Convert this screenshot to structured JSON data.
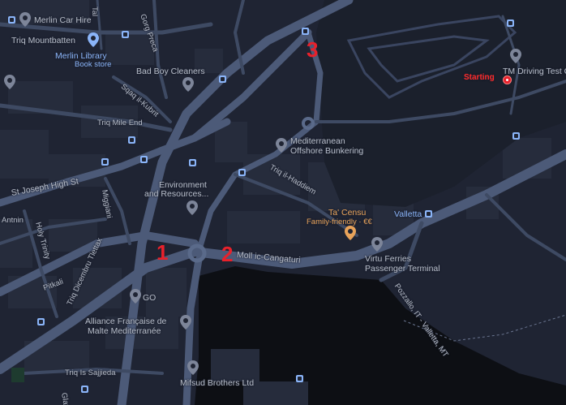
{
  "map": {
    "colors": {
      "background": "#1f2433",
      "water": "#0d0f14",
      "road": "#3e4a63",
      "road_major": "#4c5a78",
      "building": "#262c3c",
      "label": "#b7bdc9",
      "transit": "#8ab4f8",
      "marker": "#e8212b"
    },
    "numbers": {
      "one": "1",
      "two": "2",
      "three": "3"
    },
    "places": {
      "merlin_car_hire": "Merlin Car Hire",
      "triq_mountbatten": "Triq Mountbatten",
      "merlin_library": "Merlin Library",
      "book_store": "Book store",
      "bad_boy_cleaners": "Bad Boy Cleaners",
      "triq_mile_end": "Triq Mile End",
      "mediterranean": "Mediterranean",
      "offshore_bunkering": "Offshore Bunkering",
      "environment": "Environment",
      "and_resources": "and Resources...",
      "st_joseph_high_st": "St Joseph High St",
      "ta_censu": "Ta' Censu",
      "family_friendly": "Family-friendly · €€",
      "valletta": "Valletta",
      "virtu_ferries": "Virtu Ferries",
      "passenger_terminal": "Passenger Terminal",
      "moll_ic_cangaturi": "Moll ic-Cangaturi",
      "go": "GO",
      "alliance_1": "Alliance Française de",
      "alliance_2": "Malte Mediterranée",
      "mifsud_brothers": "Mifsud Brothers Ltd",
      "triq_is_sajjieda": "Triq Is Sajjieda",
      "pitkali": "Pitkali",
      "antnin": "Antnin",
      "holy_trinity": "Holy Trinity",
      "miggiani": "Miggiani",
      "triq_dicembru": "Triq Dicembru Tlettax",
      "triq_il_haddiem": "Triq il-Haddiem",
      "sqaq_il_kubrit": "Sqaq il-Kubrit",
      "pozzallo_ferry": "Pozzallo, IT - Valletta, MT",
      "tm_driving": "TM Driving Test C",
      "starting": "Starting",
      "triq_gorg_preca": "Gorg Preca",
      "tal_lanca": "Tal",
      "glaz": "Glaz"
    }
  }
}
